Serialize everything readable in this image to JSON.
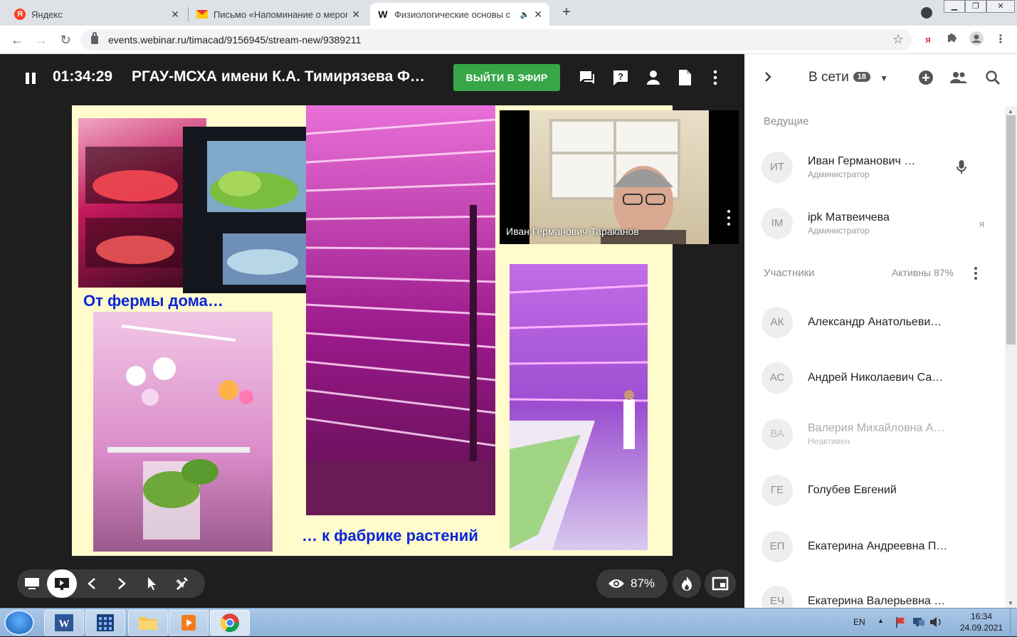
{
  "browser": {
    "tabs": [
      {
        "title": "Яндекс",
        "favicon": "yandex-icon",
        "active": false
      },
      {
        "title": "Письмо «Напоминание о меропр",
        "favicon": "mail-icon",
        "active": false
      },
      {
        "title": "Физиологические основы с",
        "favicon": "webinar-icon",
        "active": true
      }
    ],
    "url": "events.webinar.ru/timacad/9156945/stream-new/9389211",
    "ext_label": "я"
  },
  "webinar": {
    "timer": "01:34:29",
    "title": "РГАУ-МСХА имени К.А. Тимирязева   Ф…",
    "go_live_label": "ВЫЙТИ В ЭФИР",
    "slide": {
      "caption_top": "От фермы дома…",
      "caption_bottom": "… к фабрике растений"
    },
    "speaker_name": "Иван Германович Тараканов",
    "views_percent": "87%"
  },
  "panel": {
    "online_label": "В сети",
    "online_count": "18",
    "hosts_label": "Ведущие",
    "hosts": [
      {
        "initials": "ИТ",
        "name": "Иван Германович …",
        "role": "Администратор"
      },
      {
        "initials": "IM",
        "name": "ipk Матвеичева",
        "role": "Администратор",
        "tag": "я"
      }
    ],
    "participants_label": "Участники",
    "active_label": "Активны 87%",
    "participants": [
      {
        "initials": "АК",
        "name": "Александр Анатольеви…",
        "role": ""
      },
      {
        "initials": "АС",
        "name": "Андрей Николаевич Са…",
        "role": ""
      },
      {
        "initials": "ВА",
        "name": "Валерия Михайловна А…",
        "role": "Неактивен"
      },
      {
        "initials": "ГЕ",
        "name": "Голубев Евгений",
        "role": ""
      },
      {
        "initials": "ЕП",
        "name": "Екатерина Андреевна П…",
        "role": ""
      },
      {
        "initials": "ЕЧ",
        "name": "Екатерина Валерьевна …",
        "role": ""
      }
    ]
  },
  "taskbar": {
    "lang": "EN",
    "time": "16:34",
    "date": "24.09.2021"
  },
  "colors": {
    "accent_green": "#37a647",
    "slide_bg": "#fffbcc",
    "caption_blue": "#0b26d6",
    "dark_bg": "#1e1e1e"
  }
}
